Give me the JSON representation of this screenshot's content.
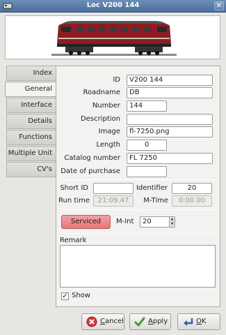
{
  "window": {
    "title": "Loc V200 144"
  },
  "tabs": [
    {
      "label": "Index"
    },
    {
      "label": "General"
    },
    {
      "label": "Interface"
    },
    {
      "label": "Details"
    },
    {
      "label": "Functions"
    },
    {
      "label": "Multiple Unit"
    },
    {
      "label": "CV's"
    }
  ],
  "active_tab": "General",
  "general": {
    "id_label": "ID",
    "id_value": "V200 144",
    "roadname_label": "Roadname",
    "roadname_value": "DB",
    "number_label": "Number",
    "number_value": "144",
    "description_label": "Description",
    "description_value": "",
    "image_label": "Image",
    "image_value": "fl-7250.png",
    "length_label": "Length",
    "length_value": "0",
    "catalog_label": "Catalog number",
    "catalog_value": "FL 7250",
    "purchase_label": "Date of purchase",
    "purchase_value": "",
    "shortid_label": "Short ID",
    "shortid_value": "",
    "identifier_label": "Identifier",
    "identifier_value": "20",
    "runtime_label": "Run time",
    "runtime_value": "21:09.47",
    "mtime_label": "M-Time",
    "mtime_value": "0:00.00",
    "serviced_label": "Serviced",
    "mint_label": "M-Int",
    "mint_value": "20",
    "remark_label": "Remark",
    "remark_value": "",
    "show_label": "Show",
    "show_checked": true
  },
  "buttons": {
    "cancel_label": "Cancel",
    "cancel_mnemonic": "C",
    "cancel_rest": "ancel",
    "apply_label": "Apply",
    "apply_mnemonic": "A",
    "apply_rest": "pply",
    "ok_label": "OK",
    "ok_mnemonic": "O",
    "ok_rest": "K"
  },
  "icons": {
    "app": "window-app-icon",
    "close": "close-icon",
    "cancel": "cancel-icon",
    "apply": "checkmark-icon",
    "ok": "ok-arrow-icon"
  },
  "colors": {
    "titlebar": "#5a7eaa",
    "serviced": "#e88080",
    "loco_body": "#8e1b24"
  }
}
